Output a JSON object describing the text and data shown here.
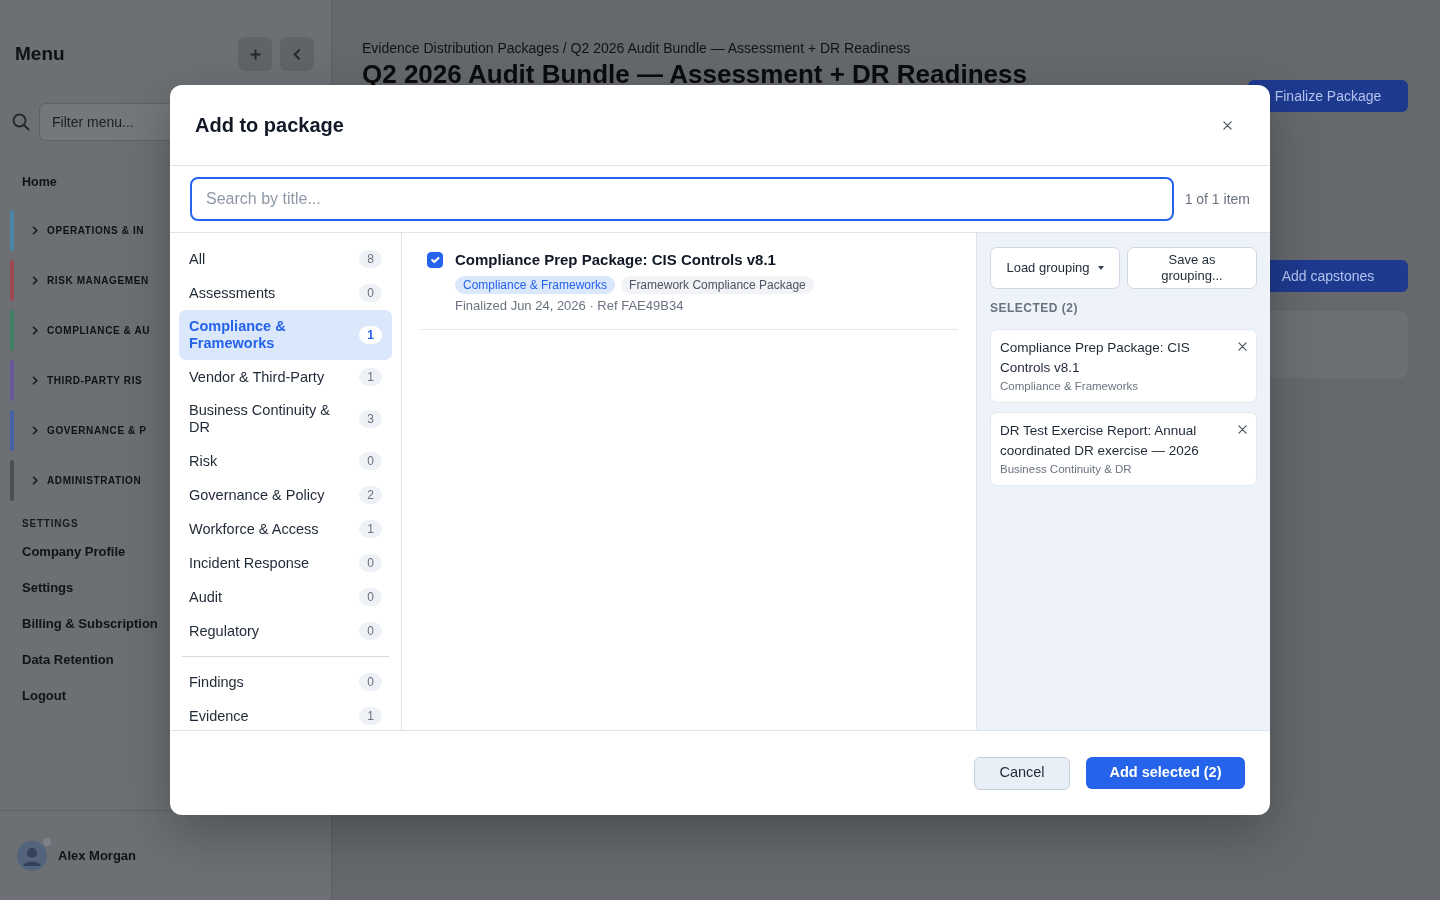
{
  "sidebar": {
    "title": "Menu",
    "filter": {
      "placeholder": "Filter menu..."
    },
    "home": "Home",
    "sections": [
      {
        "label": "OPERATIONS & IN",
        "color": "#4a87a6"
      },
      {
        "label": "RISK MANAGEMEN",
        "color": "#9c4a50"
      },
      {
        "label": "COMPLIANCE & AU",
        "color": "#3f7f62"
      },
      {
        "label": "THIRD-PARTY RIS",
        "color": "#66589a"
      },
      {
        "label": "GOVERNANCE & P",
        "color": "#4862a6"
      },
      {
        "label": "ADMINISTRATION",
        "color": "#4b4e53"
      }
    ],
    "settings_heading": "SETTINGS",
    "settings_items": [
      "Company Profile",
      "Settings",
      "Billing & Subscription",
      "Data Retention",
      "Logout"
    ],
    "user": {
      "name": "Alex Morgan"
    }
  },
  "page": {
    "breadcrumb": {
      "link": "Evidence Distribution Packages",
      "separator": "/",
      "current": "Q2 2026 Audit Bundle — Assessment + DR Readiness"
    },
    "heading": "Q2 2026 Audit Bundle — Assessment + DR Readiness",
    "finalize_button": "Finalize Package",
    "add_button": "Add capstones"
  },
  "modal": {
    "title": "Add to package",
    "search": {
      "placeholder": "Search by title..."
    },
    "result_count": "1 of 1 item",
    "filter_groups": [
      {
        "items": [
          {
            "label": "All",
            "count": "8",
            "selected": false
          },
          {
            "label": "Assessments",
            "count": "0",
            "selected": false
          },
          {
            "label": "Compliance & Frameworks",
            "count": "1",
            "selected": true
          },
          {
            "label": "Vendor & Third-Party",
            "count": "1",
            "selected": false
          },
          {
            "label": "Business Continuity & DR",
            "count": "3",
            "selected": false
          },
          {
            "label": "Risk",
            "count": "0",
            "selected": false
          },
          {
            "label": "Governance & Policy",
            "count": "2",
            "selected": false
          },
          {
            "label": "Workforce & Access",
            "count": "1",
            "selected": false
          },
          {
            "label": "Incident Response",
            "count": "0",
            "selected": false
          },
          {
            "label": "Audit",
            "count": "0",
            "selected": false
          },
          {
            "label": "Regulatory",
            "count": "0",
            "selected": false
          }
        ]
      },
      {
        "items": [
          {
            "label": "Findings",
            "count": "0",
            "selected": false
          },
          {
            "label": "Evidence",
            "count": "1",
            "selected": false
          }
        ]
      }
    ],
    "results": [
      {
        "title": "Compliance Prep Package: CIS Controls v8.1",
        "checked": true,
        "tags": [
          {
            "label": "Compliance & Frameworks",
            "kind": "category"
          },
          {
            "label": "Framework Compliance Package",
            "kind": "type"
          }
        ],
        "meta": "Finalized Jun 24, 2026 · Ref FAE49B34"
      }
    ],
    "grouping_buttons": {
      "load": "Load grouping",
      "save": "Save as grouping..."
    },
    "selected_heading": "SELECTED (2)",
    "selected": [
      {
        "title": "Compliance Prep Package: CIS Controls v8.1",
        "category": "Compliance & Frameworks"
      },
      {
        "title": "DR Test Exercise Report: Annual coordinated DR exercise — 2026",
        "category": "Business Continuity & DR"
      }
    ],
    "buttons": {
      "cancel": "Cancel",
      "submit": "Add selected (2)"
    }
  }
}
